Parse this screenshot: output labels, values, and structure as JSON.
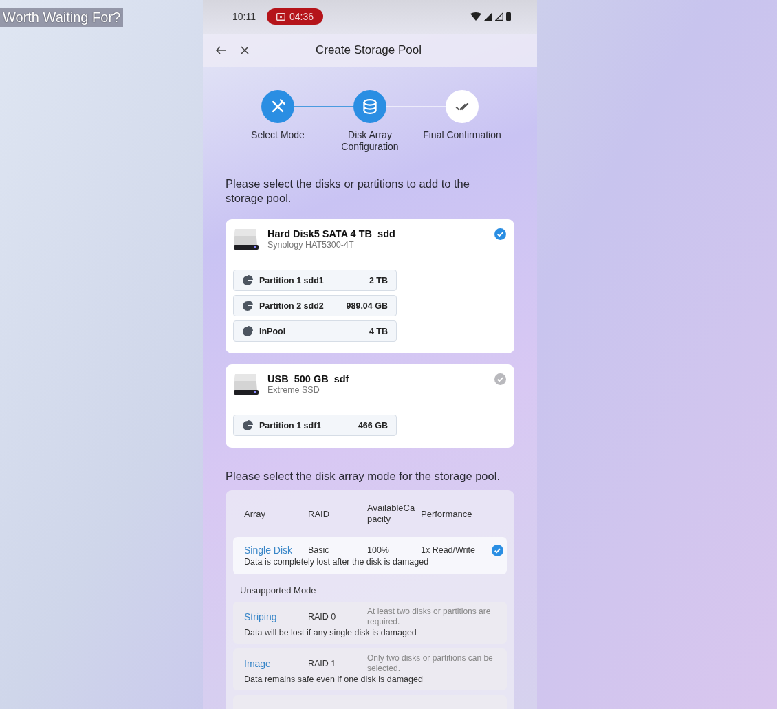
{
  "video_title": "Worth Waiting For?",
  "status_bar": {
    "time": "10:11",
    "recording_time": "04:36"
  },
  "header": {
    "title": "Create Storage Pool"
  },
  "steps": [
    {
      "label": "Select Mode",
      "active": true
    },
    {
      "label": "Disk Array Configuration",
      "active": true
    },
    {
      "label": "Final Confirmation",
      "active": false
    }
  ],
  "disk_prompt": "Please select the disks or partitions to add to the storage pool.",
  "disks": [
    {
      "name": "Hard Disk5 SATA 4 TB  sdd",
      "model": "Synology HAT5300-4T",
      "selected": true,
      "partitions": [
        {
          "name": "Partition 1 sdd1",
          "size": "2 TB"
        },
        {
          "name": "Partition 2 sdd2",
          "size": "989.04 GB"
        },
        {
          "name": "InPool",
          "size": "4 TB"
        }
      ]
    },
    {
      "name": "USB  500 GB  sdf",
      "model": "Extreme SSD",
      "selected": false,
      "partitions": [
        {
          "name": "Partition 1 sdf1",
          "size": "466 GB"
        }
      ]
    }
  ],
  "array_prompt": "Please select the disk array mode for the storage pool.",
  "array_table": {
    "columns": [
      "Array",
      "RAID",
      "AvailableCapacity",
      "Performance"
    ],
    "modes": [
      {
        "name": "Single Disk",
        "raid": "Basic",
        "capacity": "100%",
        "performance": "1x Read/Write",
        "description": "Data is completely lost after the disk is damaged",
        "selected": true
      }
    ],
    "unsupported_label": "Unsupported Mode",
    "unsupported_modes": [
      {
        "name": "Striping",
        "raid": "RAID 0",
        "requirement": "At least two disks or partitions are required.",
        "description": "Data will be lost if any single disk is damaged"
      },
      {
        "name": "Image",
        "raid": "RAID 1",
        "requirement": "Only two disks or partitions can be selected.",
        "description": "Data remains safe even if one disk is damaged"
      }
    ]
  }
}
